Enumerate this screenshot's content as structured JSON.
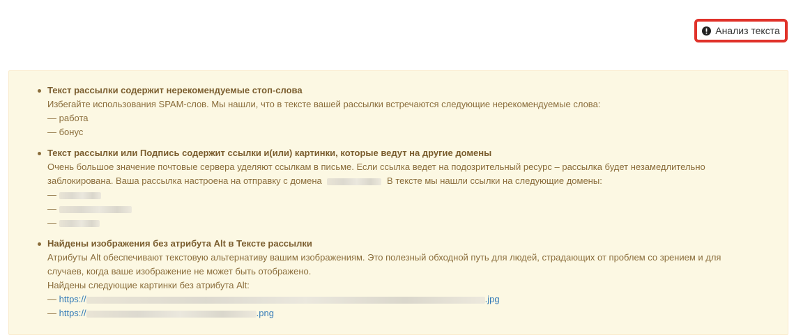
{
  "toolbar": {
    "analyze_button_label": "Анализ текста",
    "analyze_icon": "exclamation-circle-icon",
    "highlight_color": "#e0322a"
  },
  "alert": {
    "background_color": "#fcf8e3",
    "text_color": "#8a6d3b",
    "issues": [
      {
        "title": "Текст рассылки содержит нерекомендуемые стоп-слова",
        "text": "Избегайте использования SPAM-слов. Мы нашли, что в тексте вашей рассылки встречаются следующие нерекомендуемые слова:",
        "words": [
          "— работа",
          "— бонус"
        ]
      },
      {
        "title": "Текст рассылки или Подпись содержит ссылки и(или) картинки, которые ведут на другие домены",
        "text_line1": "Очень большое значение почтовые сервера уделяют ссылкам в письме. Если ссылка ведет на подозрительный ресурс – рассылка будет незамедлительно",
        "text_line2_a": "заблокирована. Ваша рассылка настроена на отправку с домена",
        "text_line2_b": "В тексте мы нашли ссылки на следующие домены:",
        "domain_dash": "—"
      },
      {
        "title": "Найдены изображения без атрибута Alt в Тексте рассылки",
        "text_line1": "Атрибуты Alt обеспечивают текстовую альтернативу вашим изображениям. Это полезный обходной путь для людей, страдающих от проблем со зрением и для",
        "text_line2": "случаев, когда ваше изображение не может быть отображено.",
        "text_line3": "Найдены следующие картинки без атрибута Alt:",
        "links": [
          {
            "dash": "—",
            "prefix": "https://",
            "suffix": ".jpg"
          },
          {
            "dash": "—",
            "prefix": "https://",
            "suffix": ".png"
          }
        ]
      }
    ]
  }
}
